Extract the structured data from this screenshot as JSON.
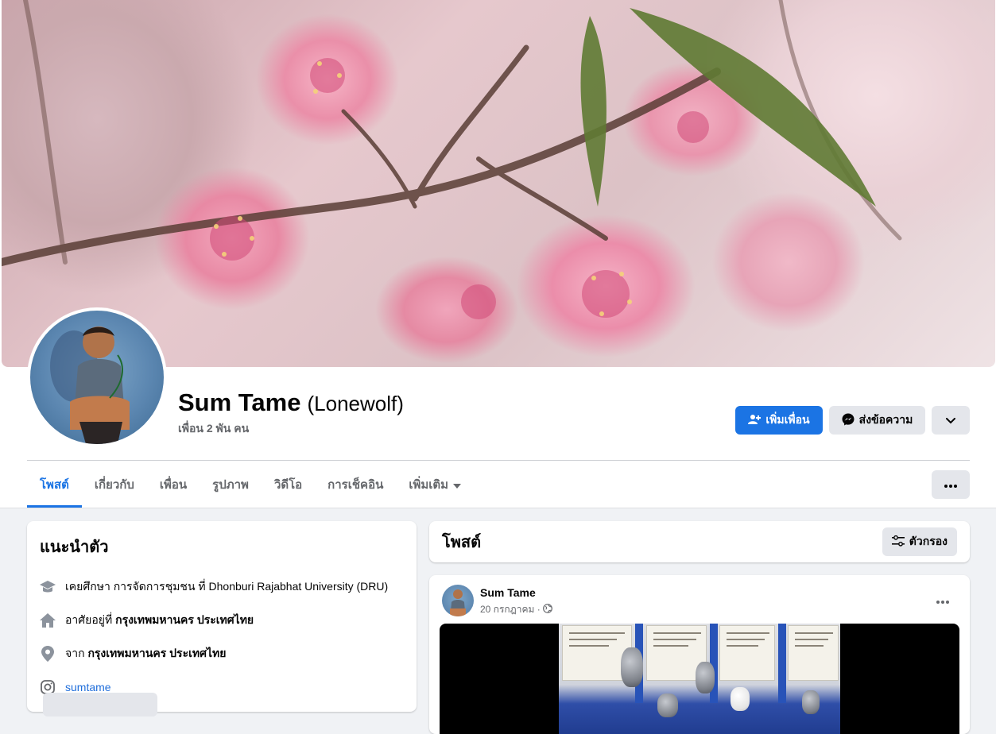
{
  "profile": {
    "name": "Sum Tame",
    "alias": "(Lonewolf)",
    "friends": "เพื่อน 2 พัน คน"
  },
  "actions": {
    "add_friend": "เพิ่มเพื่อน",
    "message": "ส่งข้อความ"
  },
  "tabs": [
    {
      "label": "โพสต์",
      "active": true
    },
    {
      "label": "เกี่ยวกับ",
      "active": false
    },
    {
      "label": "เพื่อน",
      "active": false
    },
    {
      "label": "รูปภาพ",
      "active": false
    },
    {
      "label": "วิดีโอ",
      "active": false
    },
    {
      "label": "การเช็คอิน",
      "active": false
    },
    {
      "label": "เพิ่มเติม",
      "active": false
    }
  ],
  "intro": {
    "title": "แนะนำตัว",
    "education_prefix": "เคยศึกษา การจัดการชุมชน ที่ Dhonburi Rajabhat University (DRU)",
    "lives_prefix": "อาศัยอยู่ที่",
    "lives_place": "กรุงเทพมหานคร ประเทศไทย",
    "from_prefix": "จาก",
    "from_place": "กรุงเทพมหานคร ประเทศไทย",
    "instagram": "sumtame"
  },
  "posts": {
    "title": "โพสต์",
    "filter_label": "ตัวกรอง"
  },
  "post": {
    "author": "Sum Tame",
    "date": "20 กรกฎาคม ·"
  },
  "colors": {
    "accent": "#1b74e4",
    "page_bg": "#f0f2f5"
  }
}
